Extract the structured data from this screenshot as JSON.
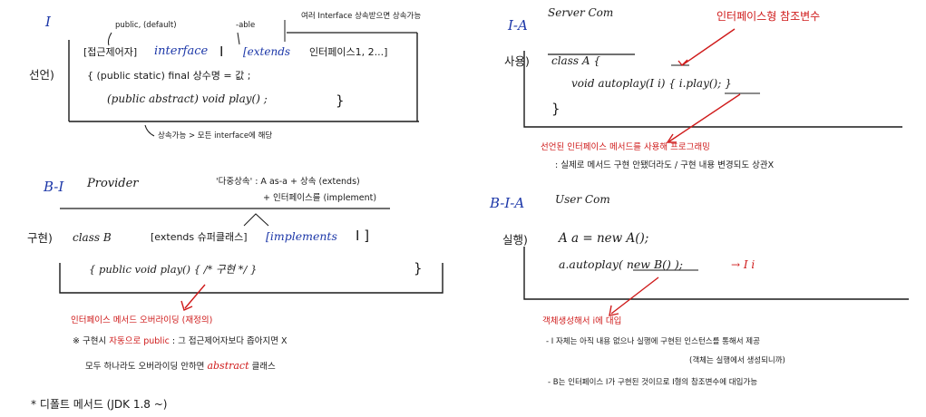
{
  "colors": {
    "ink": "#1a1a1a",
    "blue": "#1c37a8",
    "red": "#cf1a1a",
    "paper": "#ffffff"
  },
  "sectionI": {
    "tag": "I",
    "top_note_public": "public, (default)",
    "top_note_able": "-able",
    "top_note_multi": "여러 Interface 상속받으면 상속가능",
    "decl_head": "선언)",
    "line1_prefix": "[접근제어자]",
    "line1_interface": "interface",
    "line1_I": "I",
    "line1_extends": "[extends",
    "line1_rest": "인터페이스1, 2...]",
    "line2": "{ (public static) final 상수명 = 값 ;",
    "line3": "(public abstract) void play() ;",
    "line3_brace": "}",
    "bottom_note": "상속가능 > 모든 interface에 해당"
  },
  "sectionIA": {
    "tag": "I-A",
    "role": "Server Com",
    "red_note": "인터페이스형 참조변수",
    "use_head": "사용)",
    "line1": "class A {",
    "line2": "void autoplay(I i) { i.play(); }",
    "line3": "}",
    "red_line": "선언된 인터페이스 메서드를 사용해 프로그래밍",
    "note2": ": 실제로 메서드 구현 안됐더라도 / 구현 내용 변경되도 상관X"
  },
  "sectionBI": {
    "tag": "B-I",
    "role": "Provider",
    "note1": "'다중상속' : A as-a + 상속 (extends)",
    "note2": "+ 인터페이스를 (implement)",
    "impl_head": "구현)",
    "line1_class": "class B",
    "line1_extends": "[extends 슈퍼클래스]",
    "line1_impl": "[implements",
    "line1_I": "I ]",
    "line2": "{ public void play() { /* 구현 */ }",
    "line2_brace": "}",
    "red_line": "인터페이스 메서드 오버라이딩 (재정의)",
    "bullet1_prefix": "※ 구현시",
    "bullet1_red": "자동으로 public",
    "bullet1_rest": ": 그 접근제어자보다 좁아지면 X",
    "bullet2_prefix": "모두 하나라도 오버라이딩 안하면",
    "bullet2_red": "abstract",
    "bullet2_rest": "클래스"
  },
  "sectionBIA": {
    "tag": "B-I-A",
    "role": "User Com",
    "exec_head": "실행)",
    "line1": "A a = new A();",
    "line2_prefix": "a.autoplay(",
    "line2_new": "new B()",
    "line2_suffix": ");",
    "line2_arrow": "→ I i",
    "red_line": "객체생성해서 i에 대입",
    "note1": "- I 자체는 아직 내용 없으나 실행에 구현된 인스턴스를 통해서 제공",
    "note2": "(객체는 실행에서 생성되니까)",
    "note3": "- B는 인터페이스 I가 구현된 것이므로 I형의 참조변수에 대입가능"
  },
  "footer": {
    "line": "* 디폴트 메서드 (JDK 1.8 ~)"
  }
}
